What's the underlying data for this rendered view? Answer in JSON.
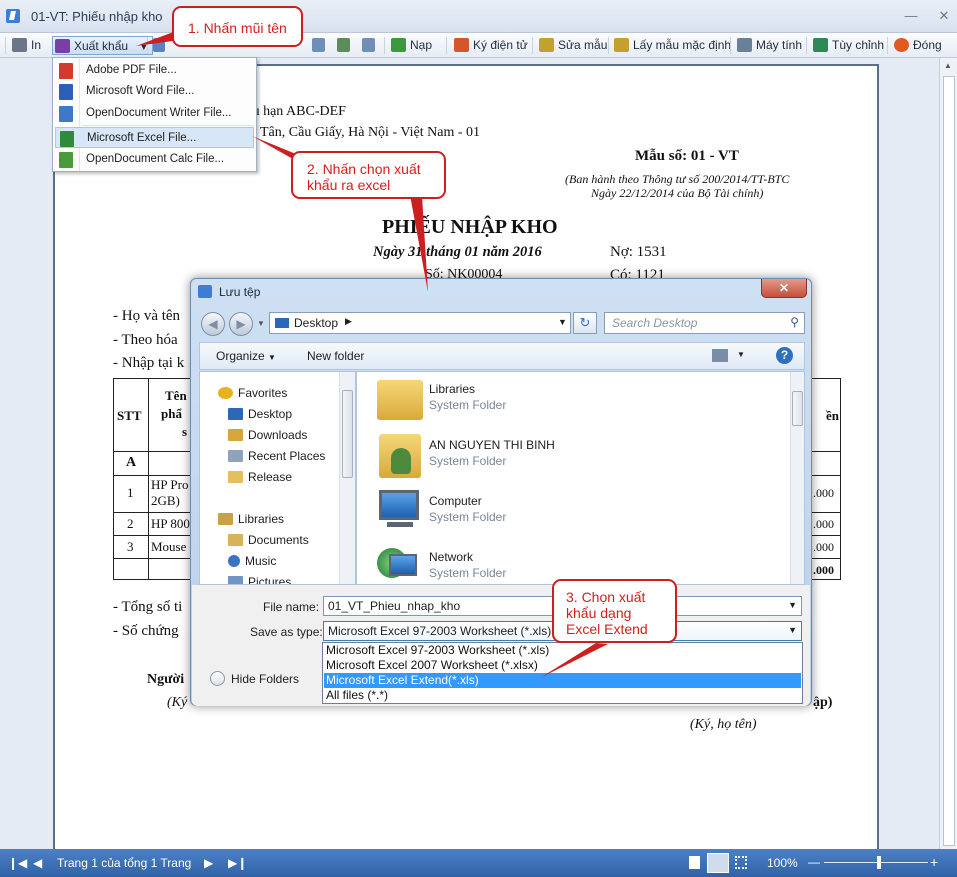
{
  "window": {
    "title": "01-VT: Phiếu nhập kho"
  },
  "toolbar": {
    "print": "In",
    "export": "Xuất khẩu",
    "reload": "Nạp",
    "esign": "Ký điện tử",
    "edit_template": "Sửa mẫu",
    "default_template": "Lấy mẫu mặc định",
    "calculator": "Máy tính",
    "customize": "Tùy chỉnh",
    "close": "Đóng"
  },
  "export_menu": {
    "items": [
      {
        "label": "Adobe PDF File...",
        "icon": "pdf-file-icon",
        "color": "#d23a2b"
      },
      {
        "label": "Microsoft Word File...",
        "icon": "doc-file-icon",
        "color": "#2b5fb8"
      },
      {
        "label": "OpenDocument Writer File...",
        "icon": "odt-file-icon",
        "color": "#3f78c8"
      },
      {
        "label": "Microsoft Excel File...",
        "icon": "xls-file-icon",
        "color": "#2f8a3a"
      },
      {
        "label": "OpenDocument Calc File...",
        "icon": "ods-file-icon",
        "color": "#4b9b3a"
      }
    ]
  },
  "callouts": {
    "c1": "1. Nhấn mũi tên",
    "c2_line1": "2. Nhấn chọn xuất",
    "c2_line2": "khẩu ra excel",
    "c3_line1": "3. Chọn xuất",
    "c3_line2": "khẩu dạng",
    "c3_line3": "Excel Extend"
  },
  "document": {
    "company": "ưu hạn ABC-DEF",
    "address": "Tân, Cầu Giấy, Hà Nội - Việt Nam - 01",
    "form_no": "Mẫu số: 01 - VT",
    "circular_line1": "(Ban hành theo Thông tư số 200/2014/TT-BTC",
    "circular_line2": "Ngày 22/12/2014 của Bộ Tài chính)",
    "title": "PHIẾU NHẬP KHO",
    "date": "Ngày 31 tháng 01 năm 2016",
    "debit": "Nợ:  1531",
    "number": "Số: NK00004",
    "credit": "Có:  1121",
    "line_name": "- Họ và tên",
    "line_invoice": "- Theo hóa",
    "line_import": "- Nhập tại k",
    "col_stt": "STT",
    "col_name1": "Tên",
    "col_name2": "phẩ",
    "col_name3": "s",
    "col_amount": "ền",
    "row_a": "A",
    "rows": [
      {
        "stt": "1",
        "name": "HP Pro",
        "name2": "2GB)",
        "amount": ".000"
      },
      {
        "stt": "2",
        "name": "HP 800",
        "amount": ".000"
      },
      {
        "stt": "3",
        "name": "Mouse",
        "amount": ".000"
      }
    ],
    "total_amount": ".000",
    "total_line": "- Tổng số ti",
    "docs_line": "- Số chứng",
    "person": "Người",
    "sign_left": "(Ký",
    "importer": "ập)",
    "sign_right": "(Ký, họ tên)"
  },
  "status": {
    "page": "Trang 1 của tổng 1 Trang",
    "zoom": "100%"
  },
  "dialog": {
    "title": "Lưu tệp",
    "address": "Desktop",
    "search_placeholder": "Search Desktop",
    "organize": "Organize",
    "new_folder": "New folder",
    "nav": {
      "favorites": "Favorites",
      "desktop": "Desktop",
      "downloads": "Downloads",
      "recent": "Recent Places",
      "release": "Release",
      "libraries": "Libraries",
      "documents": "Documents",
      "music": "Music",
      "pictures": "Pictures"
    },
    "files": [
      {
        "name": "Libraries",
        "type": "System Folder"
      },
      {
        "name": "AN NGUYEN THI BINH",
        "type": "System Folder"
      },
      {
        "name": "Computer",
        "type": "System Folder"
      },
      {
        "name": "Network",
        "type": "System Folder"
      }
    ],
    "filename_label": "File name:",
    "filename_value": "01_VT_Phieu_nhap_kho",
    "savetype_label": "Save as type:",
    "savetype_value": "Microsoft Excel 97-2003 Worksheet (*.xls)",
    "type_options": [
      "Microsoft Excel 97-2003 Worksheet (*.xls)",
      "Microsoft Excel 2007 Worksheet (*.xlsx)",
      "Microsoft Excel Extend(*.xls)",
      "All files (*.*)"
    ],
    "hide_folders": "Hide Folders"
  }
}
